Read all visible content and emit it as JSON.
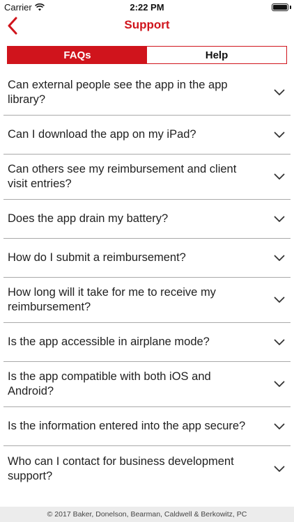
{
  "status_bar": {
    "carrier": "Carrier",
    "time": "2:22 PM"
  },
  "nav": {
    "title": "Support"
  },
  "tabs": [
    {
      "label": "FAQs",
      "active": true
    },
    {
      "label": "Help",
      "active": false
    }
  ],
  "faqs": [
    {
      "question": "Can external people see the app in the app library?"
    },
    {
      "question": "Can I download the app on my iPad?"
    },
    {
      "question": "Can others see my reimbursement and client visit entries?"
    },
    {
      "question": "Does the app drain my battery?"
    },
    {
      "question": "How do I submit a reimbursement?"
    },
    {
      "question": "How long will it take for me to receive my reimbursement?"
    },
    {
      "question": "Is the app accessible in airplane mode?"
    },
    {
      "question": "Is the app compatible with both iOS and Android?"
    },
    {
      "question": "Is the information entered into the app secure?"
    },
    {
      "question": "Who can I contact for business development support?"
    }
  ],
  "footer": {
    "text": "© 2017 Baker, Donelson, Bearman, Caldwell & Berkowitz, PC"
  },
  "colors": {
    "accent": "#d0141c",
    "divider": "#a9a9a9",
    "footer_bg": "#ececec"
  },
  "icons": {
    "back": "chevron-left-icon",
    "expand": "chevron-down-icon",
    "wifi": "wifi-icon",
    "battery": "battery-icon"
  }
}
